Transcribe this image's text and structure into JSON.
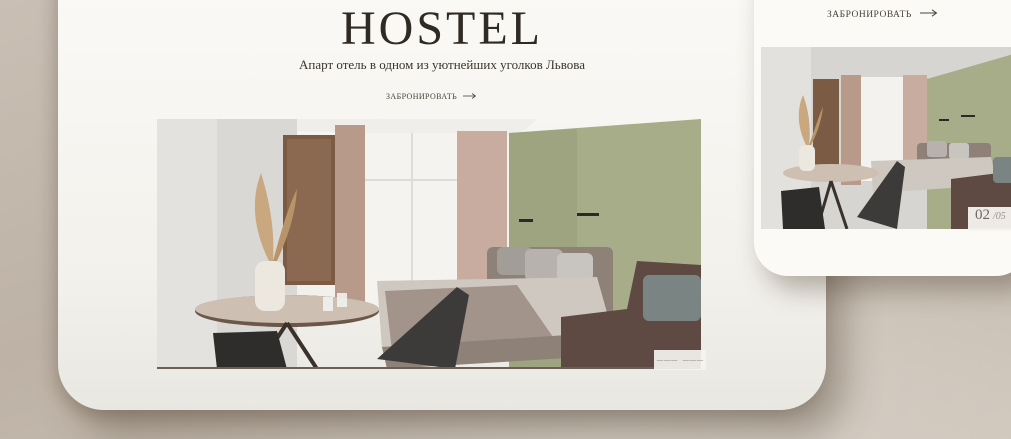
{
  "desktop": {
    "title": "HOSTEL",
    "subtitle": "Апарт отель в одном из уютнейших уголков Львова",
    "book_label": "ЗАБРОНИРОВАТЬ",
    "book_icon": "arrow-right-icon",
    "slider_prev": "———",
    "slider_next": "———"
  },
  "mobile": {
    "book_label": "ЗАБРОНИРОВАТЬ",
    "book_icon": "arrow-right-icon",
    "slide_current": "02",
    "slide_separator": "/05"
  },
  "colors": {
    "background": "#c9bfb4",
    "card": "#fbfaf7",
    "text": "#2f2a24",
    "accent_wall": "#a9b08a"
  }
}
